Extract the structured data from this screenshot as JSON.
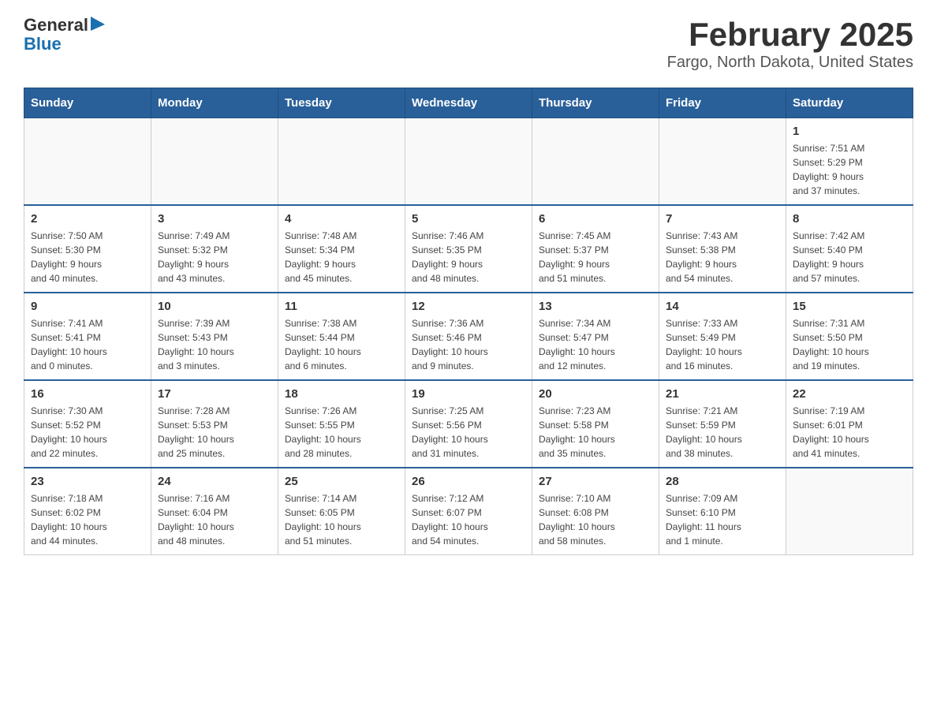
{
  "header": {
    "logo": {
      "general": "General",
      "arrow": "▶",
      "blue": "Blue"
    },
    "title": "February 2025",
    "subtitle": "Fargo, North Dakota, United States"
  },
  "days_of_week": [
    "Sunday",
    "Monday",
    "Tuesday",
    "Wednesday",
    "Thursday",
    "Friday",
    "Saturday"
  ],
  "weeks": [
    {
      "days": [
        {
          "date": "",
          "info": ""
        },
        {
          "date": "",
          "info": ""
        },
        {
          "date": "",
          "info": ""
        },
        {
          "date": "",
          "info": ""
        },
        {
          "date": "",
          "info": ""
        },
        {
          "date": "",
          "info": ""
        },
        {
          "date": "1",
          "info": "Sunrise: 7:51 AM\nSunset: 5:29 PM\nDaylight: 9 hours\nand 37 minutes."
        }
      ]
    },
    {
      "days": [
        {
          "date": "2",
          "info": "Sunrise: 7:50 AM\nSunset: 5:30 PM\nDaylight: 9 hours\nand 40 minutes."
        },
        {
          "date": "3",
          "info": "Sunrise: 7:49 AM\nSunset: 5:32 PM\nDaylight: 9 hours\nand 43 minutes."
        },
        {
          "date": "4",
          "info": "Sunrise: 7:48 AM\nSunset: 5:34 PM\nDaylight: 9 hours\nand 45 minutes."
        },
        {
          "date": "5",
          "info": "Sunrise: 7:46 AM\nSunset: 5:35 PM\nDaylight: 9 hours\nand 48 minutes."
        },
        {
          "date": "6",
          "info": "Sunrise: 7:45 AM\nSunset: 5:37 PM\nDaylight: 9 hours\nand 51 minutes."
        },
        {
          "date": "7",
          "info": "Sunrise: 7:43 AM\nSunset: 5:38 PM\nDaylight: 9 hours\nand 54 minutes."
        },
        {
          "date": "8",
          "info": "Sunrise: 7:42 AM\nSunset: 5:40 PM\nDaylight: 9 hours\nand 57 minutes."
        }
      ]
    },
    {
      "days": [
        {
          "date": "9",
          "info": "Sunrise: 7:41 AM\nSunset: 5:41 PM\nDaylight: 10 hours\nand 0 minutes."
        },
        {
          "date": "10",
          "info": "Sunrise: 7:39 AM\nSunset: 5:43 PM\nDaylight: 10 hours\nand 3 minutes."
        },
        {
          "date": "11",
          "info": "Sunrise: 7:38 AM\nSunset: 5:44 PM\nDaylight: 10 hours\nand 6 minutes."
        },
        {
          "date": "12",
          "info": "Sunrise: 7:36 AM\nSunset: 5:46 PM\nDaylight: 10 hours\nand 9 minutes."
        },
        {
          "date": "13",
          "info": "Sunrise: 7:34 AM\nSunset: 5:47 PM\nDaylight: 10 hours\nand 12 minutes."
        },
        {
          "date": "14",
          "info": "Sunrise: 7:33 AM\nSunset: 5:49 PM\nDaylight: 10 hours\nand 16 minutes."
        },
        {
          "date": "15",
          "info": "Sunrise: 7:31 AM\nSunset: 5:50 PM\nDaylight: 10 hours\nand 19 minutes."
        }
      ]
    },
    {
      "days": [
        {
          "date": "16",
          "info": "Sunrise: 7:30 AM\nSunset: 5:52 PM\nDaylight: 10 hours\nand 22 minutes."
        },
        {
          "date": "17",
          "info": "Sunrise: 7:28 AM\nSunset: 5:53 PM\nDaylight: 10 hours\nand 25 minutes."
        },
        {
          "date": "18",
          "info": "Sunrise: 7:26 AM\nSunset: 5:55 PM\nDaylight: 10 hours\nand 28 minutes."
        },
        {
          "date": "19",
          "info": "Sunrise: 7:25 AM\nSunset: 5:56 PM\nDaylight: 10 hours\nand 31 minutes."
        },
        {
          "date": "20",
          "info": "Sunrise: 7:23 AM\nSunset: 5:58 PM\nDaylight: 10 hours\nand 35 minutes."
        },
        {
          "date": "21",
          "info": "Sunrise: 7:21 AM\nSunset: 5:59 PM\nDaylight: 10 hours\nand 38 minutes."
        },
        {
          "date": "22",
          "info": "Sunrise: 7:19 AM\nSunset: 6:01 PM\nDaylight: 10 hours\nand 41 minutes."
        }
      ]
    },
    {
      "days": [
        {
          "date": "23",
          "info": "Sunrise: 7:18 AM\nSunset: 6:02 PM\nDaylight: 10 hours\nand 44 minutes."
        },
        {
          "date": "24",
          "info": "Sunrise: 7:16 AM\nSunset: 6:04 PM\nDaylight: 10 hours\nand 48 minutes."
        },
        {
          "date": "25",
          "info": "Sunrise: 7:14 AM\nSunset: 6:05 PM\nDaylight: 10 hours\nand 51 minutes."
        },
        {
          "date": "26",
          "info": "Sunrise: 7:12 AM\nSunset: 6:07 PM\nDaylight: 10 hours\nand 54 minutes."
        },
        {
          "date": "27",
          "info": "Sunrise: 7:10 AM\nSunset: 6:08 PM\nDaylight: 10 hours\nand 58 minutes."
        },
        {
          "date": "28",
          "info": "Sunrise: 7:09 AM\nSunset: 6:10 PM\nDaylight: 11 hours\nand 1 minute."
        },
        {
          "date": "",
          "info": ""
        }
      ]
    }
  ]
}
